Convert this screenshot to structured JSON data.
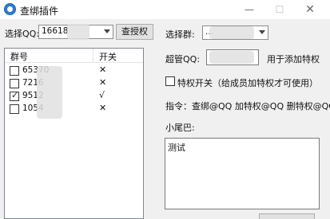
{
  "window": {
    "title": "查绑插件",
    "minimize": "—",
    "maximize": "☐",
    "close": "✕"
  },
  "select_qq": {
    "label": "选择QQ:",
    "value": "16618"
  },
  "check_auth_button": "查授权",
  "group_list": {
    "columns": [
      "群号",
      "开关"
    ],
    "rows": [
      {
        "group": "65370",
        "checked": false,
        "switch": "✕"
      },
      {
        "group": "7216",
        "checked": false,
        "switch": "✕"
      },
      {
        "group": "9512",
        "checked": true,
        "switch": "√"
      },
      {
        "group": "1054",
        "checked": false,
        "switch": "✕"
      }
    ]
  },
  "select_group": {
    "label": "选择群:",
    "value": "..."
  },
  "super_admin": {
    "label": "超管QQ:",
    "value": "",
    "suffix": "用于添加特权"
  },
  "privilege_switch": {
    "label": "特权开关（给成员加特权才可使用）",
    "checked": false
  },
  "commands": "指令：查绑@QQ 加特权@QQ 删特权@QQ",
  "tail": {
    "label": "小尾巴:",
    "value": "测试"
  }
}
